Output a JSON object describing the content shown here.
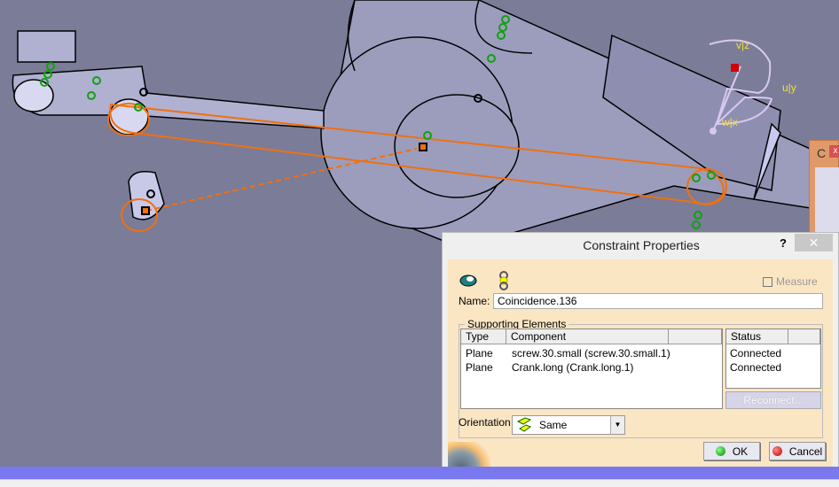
{
  "viewport": {
    "axis_labels": {
      "v": "v|z",
      "u": "u|y",
      "w": "w|x"
    },
    "colors": {
      "background": "#7b7c98",
      "highlight": "#f07010",
      "constraint": "#20a020"
    }
  },
  "mini_panel": {
    "title": "C",
    "close": "x"
  },
  "dialog": {
    "title": "Constraint Properties",
    "help": "?",
    "close": "✕",
    "measure_label": "Measure",
    "measure_checked": false,
    "name_label": "Name:",
    "name_value": "Coincidence.136",
    "supporting_elements_label": "Supporting Elements",
    "columns": [
      "Type",
      "Component"
    ],
    "status_column": "Status",
    "rows": [
      {
        "type": "Plane",
        "component": "screw.30.small (screw.30.small.1)",
        "status": "Connected"
      },
      {
        "type": "Plane",
        "component": "Crank.long (Crank.long.1)",
        "status": "Connected"
      }
    ],
    "reconnect_label": "Reconnect...",
    "orientation_label": "Orientation",
    "orientation_value": "Same",
    "ok_label": "OK",
    "cancel_label": "Cancel"
  }
}
